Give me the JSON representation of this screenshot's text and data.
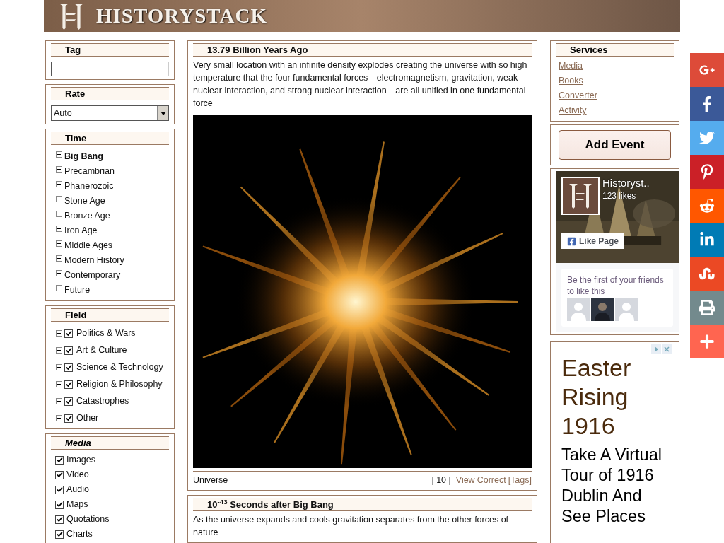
{
  "header": {
    "logo_text": "HISTORYSTACK"
  },
  "left": {
    "tag": {
      "title": "Tag"
    },
    "rate": {
      "title": "Rate",
      "value": "Auto"
    },
    "time": {
      "title": "Time",
      "items": [
        {
          "label": "Big Bang",
          "selected": true
        },
        {
          "label": "Precambrian",
          "selected": false
        },
        {
          "label": "Phanerozoic",
          "selected": false
        },
        {
          "label": "Stone Age",
          "selected": false
        },
        {
          "label": "Bronze Age",
          "selected": false
        },
        {
          "label": "Iron Age",
          "selected": false
        },
        {
          "label": "Middle Ages",
          "selected": false
        },
        {
          "label": "Modern History",
          "selected": false
        },
        {
          "label": "Contemporary",
          "selected": false
        },
        {
          "label": "Future",
          "selected": false
        }
      ]
    },
    "field": {
      "title": "Field",
      "items": [
        {
          "label": "Politics & Wars",
          "checked": true
        },
        {
          "label": "Art & Culture",
          "checked": true
        },
        {
          "label": "Science & Technology",
          "checked": true
        },
        {
          "label": "Religion & Philosophy",
          "checked": true
        },
        {
          "label": "Catastrophes",
          "checked": true
        },
        {
          "label": "Other",
          "checked": true
        }
      ]
    },
    "media": {
      "title": "Media",
      "items": [
        {
          "label": "Images",
          "checked": true
        },
        {
          "label": "Video",
          "checked": true
        },
        {
          "label": "Audio",
          "checked": true
        },
        {
          "label": "Maps",
          "checked": true
        },
        {
          "label": "Quotations",
          "checked": true
        },
        {
          "label": "Charts",
          "checked": true
        }
      ]
    }
  },
  "events": [
    {
      "time": "13.79 Billion Years Ago",
      "text": "Very small location with an infinite density explodes creating the universe with so high temperature that the four fundamental forces—electromagnetism, gravitation, weak nuclear interaction, and strong nuclear interaction—are all unified in one fundamental force",
      "image": {
        "kind": "picture"
      },
      "caption": "Universe",
      "meta": "| 10 |",
      "links": [
        "View",
        "Correct",
        "[Tags]"
      ]
    },
    {
      "time": "10$^{-43}$ Seconds after Big Bang",
      "text": "As the universe expands and cools gravitation separates from the other forces of nature"
    }
  ],
  "right": {
    "services": {
      "title": "Services",
      "links": [
        "Media",
        "Books",
        "Converter",
        "Activity"
      ]
    },
    "add_event": "Add Event",
    "facebook": {
      "page_name": "Historyst..",
      "likes": "123 likes",
      "like_button": "Like Page",
      "friends_text": "Be the first of your friends to like this"
    },
    "ad": {
      "headline": "Easter Rising 1916",
      "body": "Take A Virtual Tour of 1916 Dublin And See Places"
    }
  },
  "social": [
    {
      "kind": "google-plus",
      "color": "#dd4b39"
    },
    {
      "kind": "facebook",
      "color": "#3b5998"
    },
    {
      "kind": "twitter",
      "color": "#55acee"
    },
    {
      "kind": "pinterest",
      "color": "#cb2027"
    },
    {
      "kind": "reddit",
      "color": "#ff5700"
    },
    {
      "kind": "linkedin",
      "color": "#007bb5"
    },
    {
      "kind": "stumbleupon",
      "color": "#eb4924"
    },
    {
      "kind": "print",
      "color": "#738a8d"
    },
    {
      "kind": "more",
      "color": "#ff6550"
    }
  ]
}
